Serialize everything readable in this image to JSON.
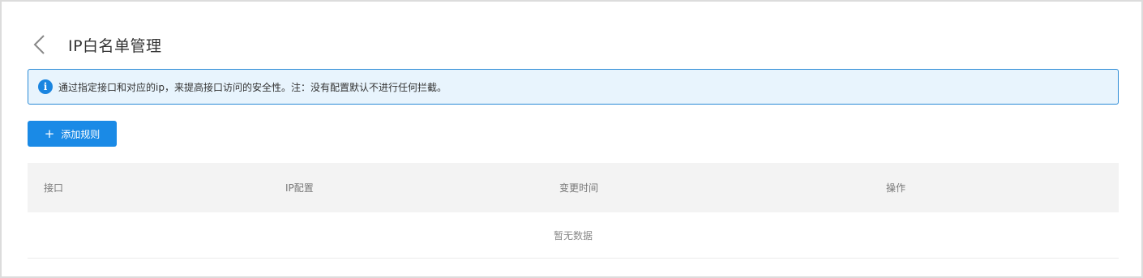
{
  "header": {
    "title": "IP白名单管理",
    "back_icon": "chevron-left-icon"
  },
  "alert": {
    "icon": "info-icon",
    "icon_glyph": "i",
    "text": "通过指定接口和对应的ip，来提高接口访问的安全性。注：没有配置默认不进行任何拦截。",
    "accent": "#1a85e0"
  },
  "toolbar": {
    "add_label": "添加规则",
    "add_icon": "plus-icon",
    "accent": "#1a8ae6"
  },
  "table": {
    "columns": [
      "接口",
      "IP配置",
      "变更时间",
      "操作"
    ],
    "rows": [],
    "empty_text": "暂无数据"
  }
}
